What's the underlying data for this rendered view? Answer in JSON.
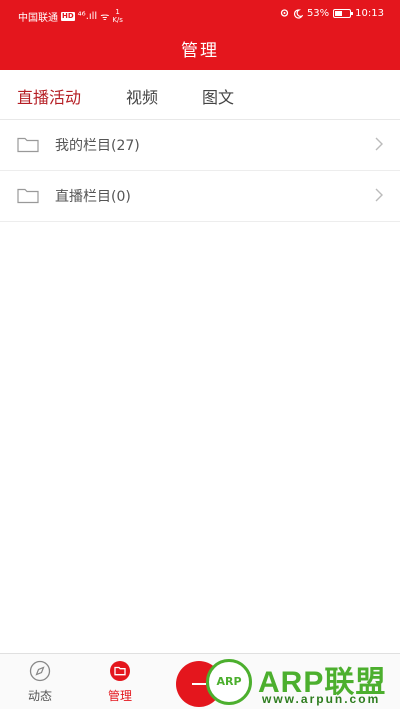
{
  "status_bar": {
    "carrier": "中国联通",
    "hd_badge": "HD",
    "signal": "⁴⁶.ıll",
    "wifi": "ᯤ",
    "speed_top": "1",
    "speed_unit": "K/s",
    "battery": "53%",
    "battery_level": 0.53,
    "time": "10:13"
  },
  "header": {
    "title": "管理"
  },
  "tabs": [
    {
      "label": "直播活动",
      "active": true
    },
    {
      "label": "视频",
      "active": false
    },
    {
      "label": "图文",
      "active": false
    }
  ],
  "list": [
    {
      "label": "我的栏目(27)"
    },
    {
      "label": "直播栏目(0)"
    }
  ],
  "bottom_nav": [
    {
      "label": "动态",
      "icon": "compass-icon",
      "active": false
    },
    {
      "label": "管理",
      "icon": "folder-icon",
      "active": true
    }
  ],
  "fab": {
    "icon": "plus-icon"
  },
  "watermark": {
    "logo": "ARP",
    "text": "ARP联盟",
    "url": "www.arpun.com"
  },
  "colors": {
    "brand": "#e4161d",
    "active_tab": "#b51e24",
    "watermark": "#4caf2e"
  }
}
